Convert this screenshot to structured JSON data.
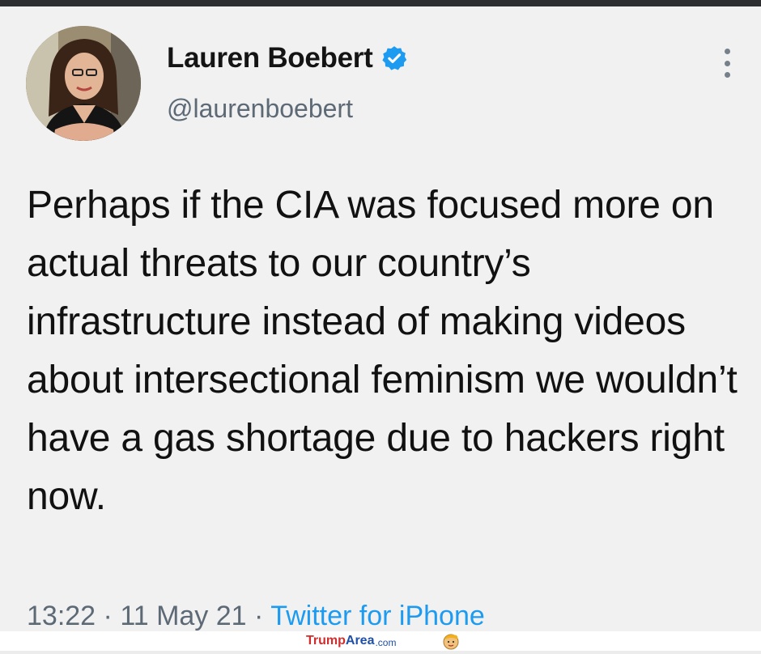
{
  "tweet": {
    "author_name": "Lauren Boebert",
    "handle": "@laurenboebert",
    "verified": true,
    "text": "Perhaps if the CIA was focused more on actual threats to our country’s infrastructure instead of making videos about intersectional feminism we wouldn’t have a gas shortage due to hackers right now.",
    "time": "13:22",
    "separator": "·",
    "date": "11 May 21",
    "source": "Twitter for iPhone"
  },
  "icons": {
    "verified": "verified-badge-icon",
    "more": "more-vertical-icon"
  },
  "watermark": {
    "part1": "Trump",
    "part2": "Area",
    "part3": ".com"
  },
  "colors": {
    "accent": "#1d9bf0",
    "text": "#111111",
    "muted": "#5d6a76"
  }
}
